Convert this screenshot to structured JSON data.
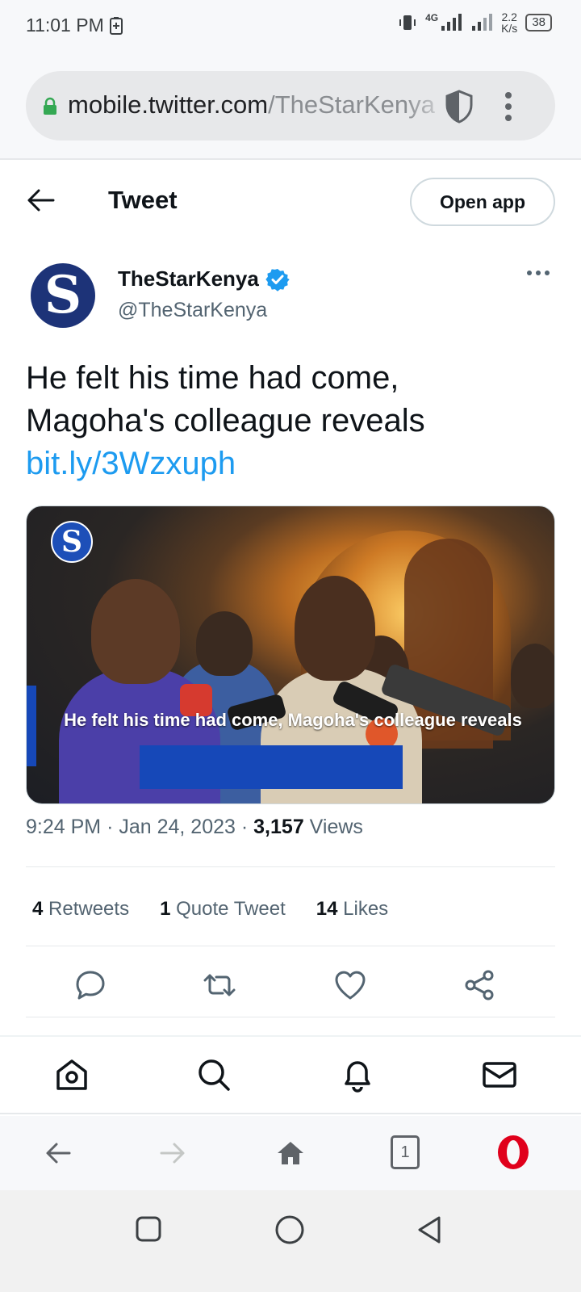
{
  "status_bar": {
    "time": "11:01 PM",
    "network": "4G",
    "speed_value": "2.2",
    "speed_unit": "K/s",
    "battery": "38"
  },
  "browser": {
    "url_domain": "mobile.twitter.com",
    "url_path": "/TheStarKenya"
  },
  "header": {
    "title": "Tweet",
    "open_app_label": "Open app"
  },
  "tweet": {
    "author_name": "TheStarKenya",
    "author_handle": "@TheStarKenya",
    "verified": true,
    "text_line1": "He felt his time had come,",
    "text_line2": "Magoha's colleague reveals",
    "link": "bit.ly/3Wzxuph",
    "media_caption": "He felt his time had come, Magoha's colleague reveals",
    "time": "9:24 PM",
    "date": "Jan 24, 2023",
    "views_count": "3,157",
    "views_label": "Views",
    "separator": "·"
  },
  "stats": {
    "retweets_count": "4",
    "retweets_label": "Retweets",
    "quotes_count": "1",
    "quotes_label": "Quote Tweet",
    "likes_count": "14",
    "likes_label": "Likes"
  },
  "browser_nav": {
    "tab_count": "1"
  },
  "colors": {
    "link": "#1d9bf0",
    "verified": "#1d9bf0",
    "opera_red": "#e0001b",
    "text_secondary": "#536471"
  }
}
